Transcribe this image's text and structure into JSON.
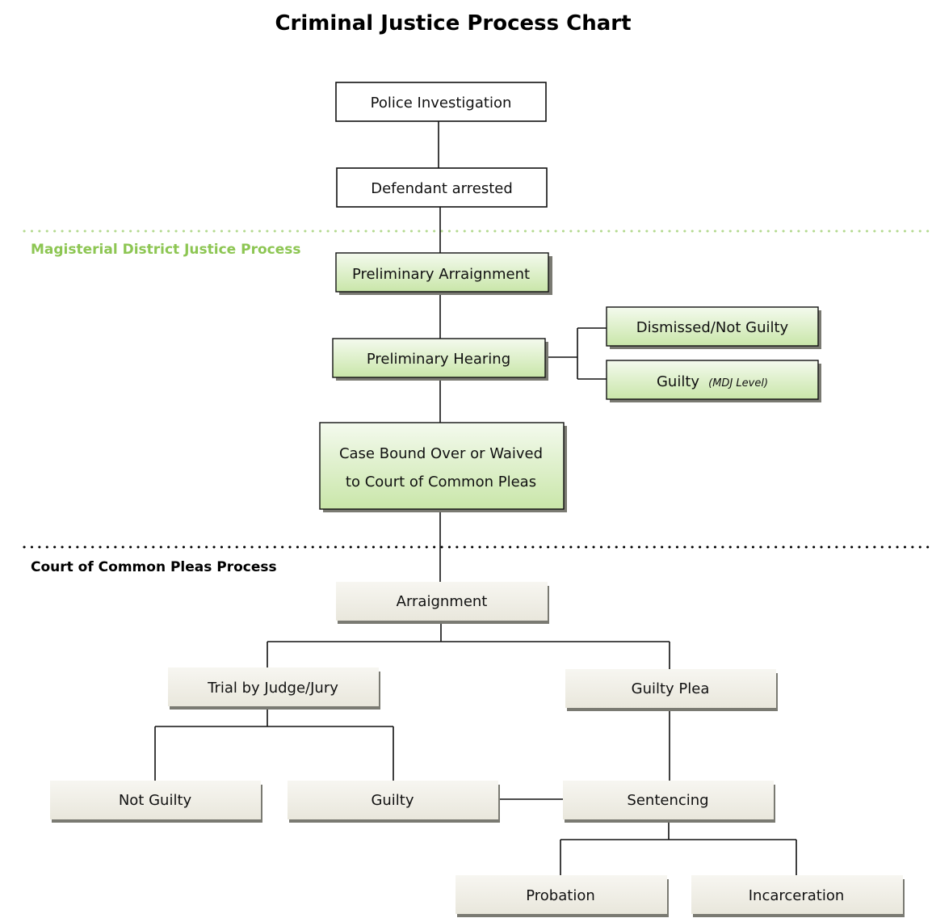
{
  "title": "Criminal Justice Process Chart",
  "colors": {
    "green_section": "#8dc653",
    "black_section": "#000000",
    "plain_fill": "#ffffff",
    "green_fill_top": "#f4faee",
    "green_fill_bottom": "#c9e6a9",
    "beige_fill_top": "#f7f6f1",
    "beige_fill_bottom": "#e9e7dc",
    "shadow": "#7a7a72"
  },
  "sections": [
    {
      "id": "mdj",
      "label": "Magisterial District Justice Process",
      "style": "green"
    },
    {
      "id": "ccp",
      "label": "Court of Common Pleas Process",
      "style": "black"
    }
  ],
  "nodes": [
    {
      "id": "police",
      "label": "Police Investigation",
      "style": "plain"
    },
    {
      "id": "arrested",
      "label": "Defendant arrested",
      "style": "plain"
    },
    {
      "id": "prelim_arraign",
      "label": "Preliminary Arraignment",
      "style": "green"
    },
    {
      "id": "prelim_hearing",
      "label": "Preliminary Hearing",
      "style": "green"
    },
    {
      "id": "dismissed",
      "label": "Dismissed/Not Guilty",
      "style": "green"
    },
    {
      "id": "guilty_mdj",
      "label": "Guilty",
      "sublabel": "(MDJ Level)",
      "style": "green"
    },
    {
      "id": "bound_over",
      "label": "Case Bound Over or Waived",
      "label2": "to Court of Common Pleas",
      "style": "green"
    },
    {
      "id": "arraignment",
      "label": "Arraignment",
      "style": "beige"
    },
    {
      "id": "trial",
      "label": "Trial by Judge/Jury",
      "style": "beige"
    },
    {
      "id": "guilty_plea",
      "label": "Guilty Plea",
      "style": "beige"
    },
    {
      "id": "not_guilty",
      "label": "Not Guilty",
      "style": "beige"
    },
    {
      "id": "guilty",
      "label": "Guilty",
      "style": "beige"
    },
    {
      "id": "sentencing",
      "label": "Sentencing",
      "style": "beige"
    },
    {
      "id": "probation",
      "label": "Probation",
      "style": "beige"
    },
    {
      "id": "incarceration",
      "label": "Incarceration",
      "style": "beige"
    }
  ],
  "edges": [
    [
      "police",
      "arrested"
    ],
    [
      "arrested",
      "prelim_arraign"
    ],
    [
      "prelim_arraign",
      "prelim_hearing"
    ],
    [
      "prelim_hearing",
      "dismissed"
    ],
    [
      "prelim_hearing",
      "guilty_mdj"
    ],
    [
      "prelim_hearing",
      "bound_over"
    ],
    [
      "bound_over",
      "arraignment"
    ],
    [
      "arraignment",
      "trial"
    ],
    [
      "arraignment",
      "guilty_plea"
    ],
    [
      "trial",
      "not_guilty"
    ],
    [
      "trial",
      "guilty"
    ],
    [
      "guilty_plea",
      "sentencing"
    ],
    [
      "guilty",
      "sentencing"
    ],
    [
      "sentencing",
      "probation"
    ],
    [
      "sentencing",
      "incarceration"
    ]
  ]
}
